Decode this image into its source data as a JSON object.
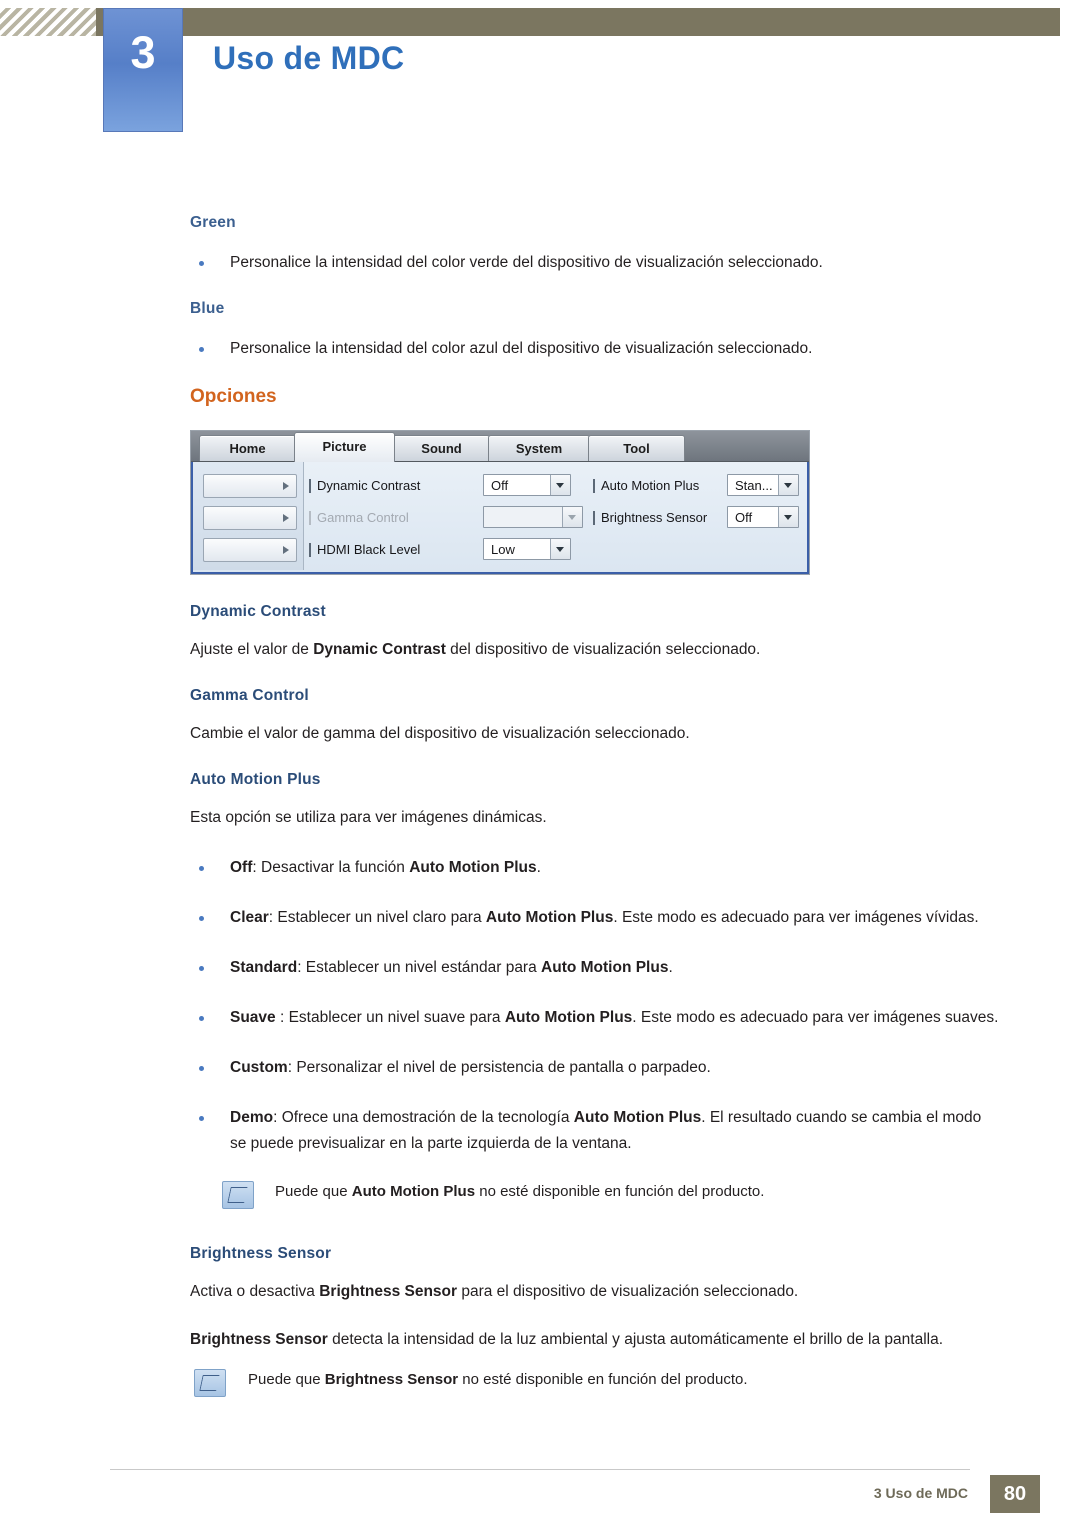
{
  "header": {
    "chapter_number": "3",
    "chapter_title": "Uso de MDC"
  },
  "sections": {
    "green_head": "Green",
    "green_bullet": "Personalice la intensidad del color verde del dispositivo de visualización seleccionado.",
    "blue_head": "Blue",
    "blue_bullet": "Personalice la intensidad del color azul del dispositivo de visualización seleccionado.",
    "options_head": "Opciones",
    "dynamic_contrast_head": "Dynamic Contrast",
    "dynamic_contrast_text_1": "Ajuste el valor de ",
    "dynamic_contrast_bold": "Dynamic Contrast",
    "dynamic_contrast_text_2": " del dispositivo de visualización seleccionado.",
    "gamma_head": "Gamma Control",
    "gamma_text": "Cambie el valor de gamma del dispositivo de visualización seleccionado.",
    "auto_motion_head": "Auto Motion Plus",
    "auto_motion_intro": "Esta opción se utiliza para ver imágenes dinámicas.",
    "auto_motion_items": [
      {
        "label": "Off",
        "text_1": ": Desactivar la función ",
        "bold": "Auto Motion Plus",
        "text_2": "."
      },
      {
        "label": "Clear",
        "text_1": ": Establecer un nivel claro para ",
        "bold": "Auto Motion Plus",
        "text_2": ". Este modo es adecuado para ver imágenes vívidas."
      },
      {
        "label": "Standard",
        "text_1": ": Establecer un nivel estándar para ",
        "bold": "Auto Motion Plus",
        "text_2": "."
      },
      {
        "label": "Suave",
        "text_1": " : Establecer un nivel suave para ",
        "bold": "Auto Motion Plus",
        "text_2": ". Este modo es adecuado para ver imágenes suaves."
      },
      {
        "label": "Custom",
        "text_1": ": Personalizar el nivel de persistencia de pantalla o parpadeo.",
        "bold": "",
        "text_2": ""
      },
      {
        "label": "Demo",
        "text_1": ": Ofrece una demostración de la tecnología ",
        "bold": "Auto Motion Plus",
        "text_2": ". El resultado cuando se cambia el modo se puede previsualizar en la parte izquierda de la ventana."
      }
    ],
    "note_auto_motion": {
      "text_1": "Puede que ",
      "bold": "Auto Motion Plus",
      "text_2": " no esté disponible en función del producto."
    },
    "brightness_head": "Brightness Sensor",
    "brightness_text_1a": "Activa o desactiva ",
    "brightness_text_1b": "Brightness Sensor",
    "brightness_text_1c": " para el dispositivo de visualización seleccionado.",
    "brightness_text_2a": "Brightness Sensor",
    "brightness_text_2b": " detecta la intensidad de la luz ambiental y ajusta automáticamente el brillo de la pantalla.",
    "note_brightness": {
      "text_1": "Puede que ",
      "bold": "Brightness Sensor",
      "text_2": " no esté disponible en función del producto."
    }
  },
  "mdc_screenshot": {
    "tabs": [
      {
        "label": "Home",
        "active": false
      },
      {
        "label": "Picture",
        "active": true
      },
      {
        "label": "Sound",
        "active": false
      },
      {
        "label": "System",
        "active": false
      },
      {
        "label": "Tool",
        "active": false
      }
    ],
    "left_controls": [
      "slider-1",
      "slider-2",
      "slider-3"
    ],
    "fields": [
      {
        "label": "Dynamic Contrast",
        "value": "Off",
        "disabled": false
      },
      {
        "label": "Gamma Control",
        "value": "",
        "disabled": true
      },
      {
        "label": "HDMI Black Level",
        "value": "Low",
        "disabled": false
      },
      {
        "label": "Auto Motion Plus",
        "value": "Stan...",
        "disabled": false
      },
      {
        "label": "Brightness Sensor",
        "value": "Off",
        "disabled": false
      }
    ]
  },
  "footer": {
    "text": "3 Uso de MDC",
    "page": "80"
  }
}
